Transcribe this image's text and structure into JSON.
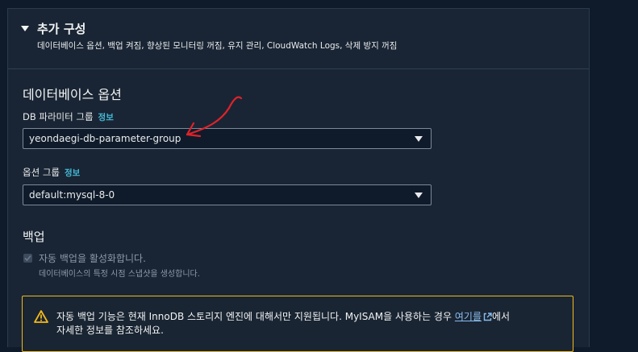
{
  "section": {
    "title": "추가 구성",
    "description": "데이터베이스 옵션, 백업 켜짐, 향상된 모니터링 꺼짐, 유지 관리, CloudWatch Logs, 삭제 방지 꺼짐"
  },
  "db_options": {
    "title": "데이터베이스 옵션",
    "parameter_group": {
      "label": "DB 파라미터 그룹",
      "info": "정보",
      "value": "yeondaegi-db-parameter-group"
    },
    "option_group": {
      "label": "옵션 그룹",
      "info": "정보",
      "value": "default:mysql-8-0"
    }
  },
  "backup": {
    "title": "백업",
    "checkbox_label": "자동 백업을 활성화합니다.",
    "checkbox_desc": "데이터베이스의 특정 시점 스냅샷을 생성합니다.",
    "checked": true
  },
  "alert": {
    "line1_prefix": "자동 백업 기능은 현재 InnoDB 스토리지 엔진에 대해서만 지원됩니다. MyISAM을 사용하는 경우",
    "link": "여기를",
    "line1_suffix": "에서",
    "line2": "자세한 정보를 참조하세요."
  },
  "colors": {
    "background": "#0f1b2a",
    "panel": "#192534",
    "info_link": "#44b9d6",
    "warning": "#f2b91b",
    "annotation": "#e0222a"
  }
}
